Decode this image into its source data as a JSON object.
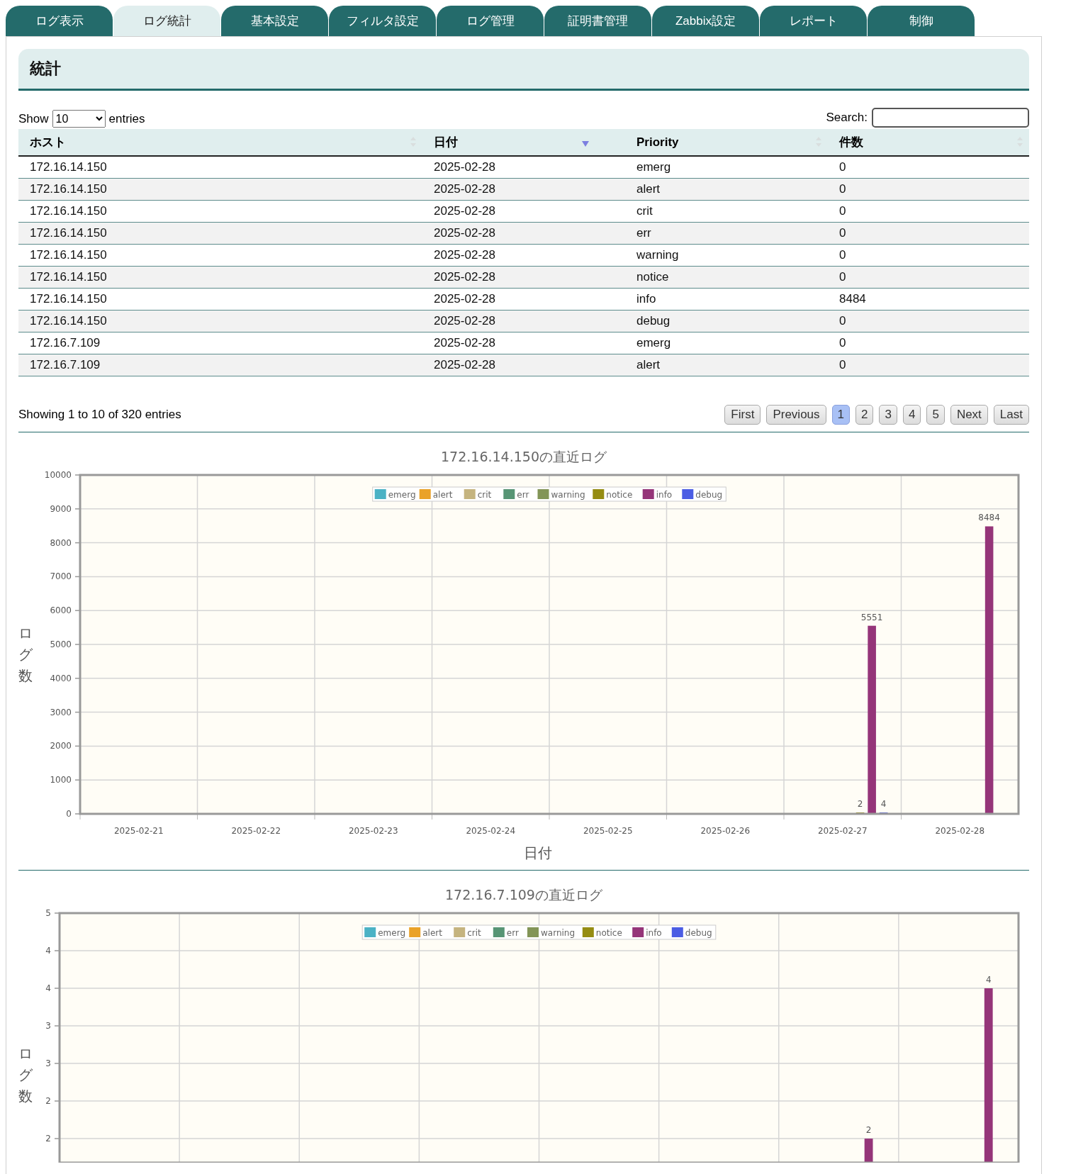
{
  "tabs": [
    {
      "label": "ログ表示",
      "selected": false
    },
    {
      "label": "ログ統計",
      "selected": true
    },
    {
      "label": "基本設定",
      "selected": false
    },
    {
      "label": "フィルタ設定",
      "selected": false
    },
    {
      "label": "ログ管理",
      "selected": false
    },
    {
      "label": "証明書管理",
      "selected": false
    },
    {
      "label": "Zabbix設定",
      "selected": false
    },
    {
      "label": "レポート",
      "selected": false
    },
    {
      "label": "制御",
      "selected": false
    }
  ],
  "section_title": "統計",
  "length_control": {
    "before": "Show",
    "value": "10",
    "after": "entries"
  },
  "search": {
    "label": "Search:"
  },
  "table": {
    "columns": [
      {
        "label": "ホスト",
        "sorted": false
      },
      {
        "label": "日付",
        "sorted": true
      },
      {
        "label": "Priority",
        "sorted": false
      },
      {
        "label": "件数",
        "sorted": false
      }
    ],
    "rows": [
      [
        "172.16.14.150",
        "2025-02-28",
        "emerg",
        "0"
      ],
      [
        "172.16.14.150",
        "2025-02-28",
        "alert",
        "0"
      ],
      [
        "172.16.14.150",
        "2025-02-28",
        "crit",
        "0"
      ],
      [
        "172.16.14.150",
        "2025-02-28",
        "err",
        "0"
      ],
      [
        "172.16.14.150",
        "2025-02-28",
        "warning",
        "0"
      ],
      [
        "172.16.14.150",
        "2025-02-28",
        "notice",
        "0"
      ],
      [
        "172.16.14.150",
        "2025-02-28",
        "info",
        "8484"
      ],
      [
        "172.16.14.150",
        "2025-02-28",
        "debug",
        "0"
      ],
      [
        "172.16.7.109",
        "2025-02-28",
        "emerg",
        "0"
      ],
      [
        "172.16.7.109",
        "2025-02-28",
        "alert",
        "0"
      ]
    ]
  },
  "info": "Showing 1 to 10 of 320 entries",
  "pagination": {
    "first": "First",
    "previous": "Previous",
    "pages": [
      {
        "label": "1",
        "selected": true
      },
      {
        "label": "2",
        "selected": false
      },
      {
        "label": "3",
        "selected": false
      },
      {
        "label": "4",
        "selected": false
      },
      {
        "label": "5",
        "selected": false
      }
    ],
    "next": "Next",
    "last": "Last"
  },
  "charts": [
    {
      "chart_data": {
        "type": "bar",
        "title": "172.16.14.150の直近ログ",
        "xlabel": "日付",
        "ylabel": "ログ数",
        "categories": [
          "2025-02-21",
          "2025-02-22",
          "2025-02-23",
          "2025-02-24",
          "2025-02-25",
          "2025-02-26",
          "2025-02-27",
          "2025-02-28"
        ],
        "ylim": [
          0,
          10000
        ],
        "yticks": [
          0,
          1000,
          2000,
          3000,
          4000,
          5000,
          6000,
          7000,
          8000,
          9000,
          10000
        ],
        "grid": true,
        "legend": "top",
        "series": [
          {
            "name": "emerg",
            "color": "#4bb2c5",
            "values": [
              null,
              null,
              null,
              null,
              null,
              null,
              null,
              null
            ]
          },
          {
            "name": "alert",
            "color": "#eaa228",
            "values": [
              null,
              null,
              null,
              null,
              null,
              null,
              null,
              null
            ]
          },
          {
            "name": "crit",
            "color": "#c5b47f",
            "values": [
              null,
              null,
              null,
              null,
              null,
              null,
              null,
              null
            ]
          },
          {
            "name": "err",
            "color": "#579575",
            "values": [
              null,
              null,
              null,
              null,
              null,
              null,
              null,
              null
            ]
          },
          {
            "name": "warning",
            "color": "#839557",
            "values": [
              null,
              null,
              null,
              null,
              null,
              null,
              null,
              null
            ]
          },
          {
            "name": "notice",
            "color": "#958c12",
            "values": [
              null,
              null,
              null,
              null,
              null,
              null,
              2,
              null
            ],
            "value_labels": [
              null,
              null,
              null,
              null,
              null,
              null,
              "2",
              null
            ]
          },
          {
            "name": "info",
            "color": "#953579",
            "values": [
              null,
              null,
              null,
              null,
              null,
              null,
              5551,
              8484
            ],
            "value_labels": [
              null,
              null,
              null,
              null,
              null,
              null,
              "5551",
              "8484"
            ]
          },
          {
            "name": "debug",
            "color": "#4b5de4",
            "values": [
              null,
              null,
              null,
              null,
              null,
              null,
              4,
              null
            ],
            "value_labels": [
              null,
              null,
              null,
              null,
              null,
              null,
              "4",
              null
            ]
          }
        ]
      }
    },
    {
      "chart_data": {
        "type": "bar",
        "title": "172.16.7.109の直近ログ",
        "ylabel": "ログ数",
        "ylim": [
          1.68,
          5
        ],
        "yticks": [
          {
            "value": 2,
            "label": "2"
          },
          {
            "value": 2.5,
            "label": "2"
          },
          {
            "value": 3,
            "label": "3"
          },
          {
            "value": 3.5,
            "label": "3"
          },
          {
            "value": 4,
            "label": "4"
          },
          {
            "value": 4.5,
            "label": "4"
          },
          {
            "value": 5,
            "label": "5"
          }
        ],
        "grid": true,
        "legend": "top",
        "series": [
          {
            "name": "emerg",
            "color": "#4bb2c5",
            "values": [
              null,
              null,
              null,
              null,
              null,
              null,
              null,
              null
            ]
          },
          {
            "name": "alert",
            "color": "#eaa228",
            "values": [
              null,
              null,
              null,
              null,
              null,
              null,
              null,
              null
            ]
          },
          {
            "name": "crit",
            "color": "#c5b47f",
            "values": [
              null,
              null,
              null,
              null,
              null,
              null,
              null,
              null
            ]
          },
          {
            "name": "err",
            "color": "#579575",
            "values": [
              null,
              null,
              null,
              null,
              null,
              null,
              null,
              null
            ]
          },
          {
            "name": "warning",
            "color": "#839557",
            "values": [
              null,
              null,
              null,
              null,
              null,
              null,
              null,
              null
            ]
          },
          {
            "name": "notice",
            "color": "#958c12",
            "values": [
              null,
              null,
              null,
              null,
              null,
              null,
              null,
              null
            ]
          },
          {
            "name": "info",
            "color": "#953579",
            "values": [
              null,
              null,
              null,
              null,
              null,
              null,
              2,
              4
            ],
            "value_labels": [
              null,
              null,
              null,
              null,
              null,
              null,
              "2",
              "4"
            ]
          },
          {
            "name": "debug",
            "color": "#4b5de4",
            "values": [
              null,
              null,
              null,
              null,
              null,
              null,
              null,
              null
            ]
          }
        ]
      }
    }
  ]
}
